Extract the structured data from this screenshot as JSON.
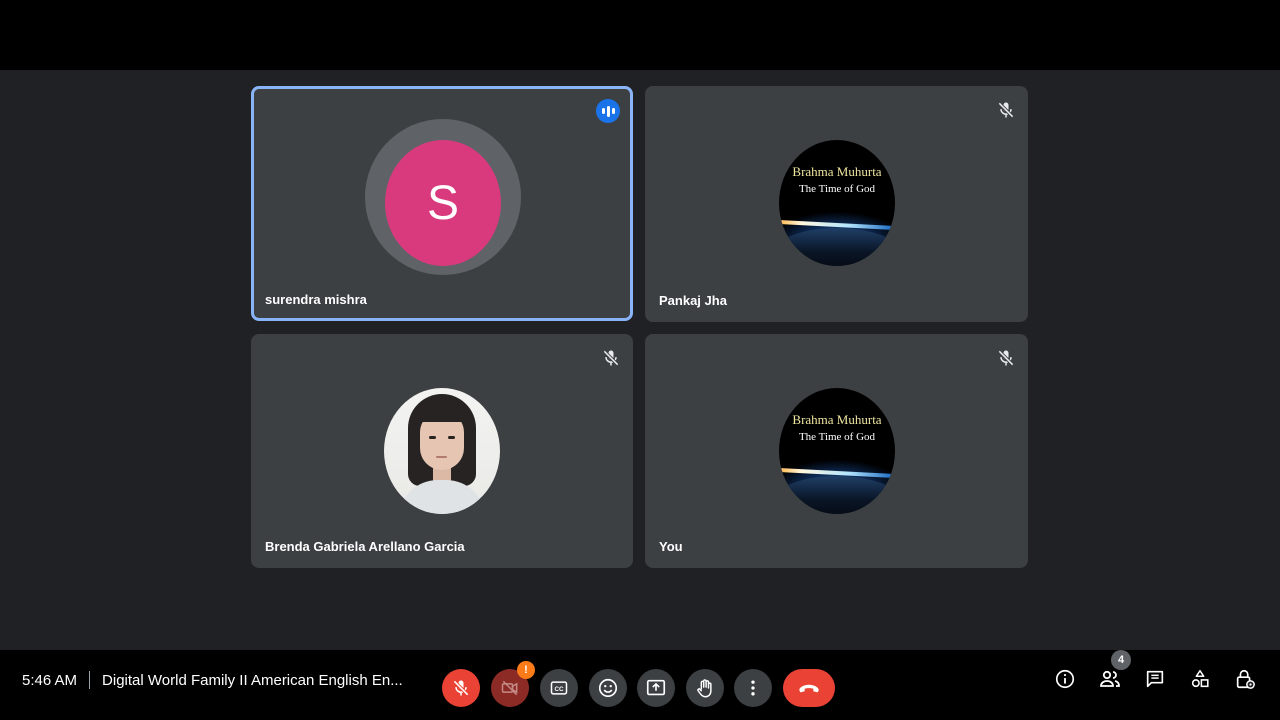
{
  "tiles": [
    {
      "name": "surendra mishra",
      "avatar_letter": "S",
      "state": "speaking"
    },
    {
      "name": "Pankaj Jha",
      "avatar_title": "Brahma Muhurta",
      "avatar_subtitle": "The Time of God",
      "state": "muted"
    },
    {
      "name": "Brenda Gabriela Arellano Garcia",
      "state": "muted"
    },
    {
      "name": "You",
      "avatar_title": "Brahma Muhurta",
      "avatar_subtitle": "The Time of God",
      "state": "muted"
    }
  ],
  "bottom_bar": {
    "time": "5:46 AM",
    "meeting_title": "Digital World Family II American English En...",
    "camera_warning": "!",
    "participants_count": "4"
  },
  "icons": {
    "mic": "mic-off-icon",
    "camera": "camera-off-icon",
    "captions": "captions-icon",
    "reactions": "emoji-icon",
    "present": "present-screen-icon",
    "hand": "raise-hand-icon",
    "more": "more-options-icon",
    "leave": "leave-call-icon",
    "info": "info-icon",
    "people": "people-icon",
    "chat": "chat-icon",
    "activities": "activities-icon",
    "host": "host-controls-icon"
  },
  "colors": {
    "background": "#202124",
    "tile": "#3c4043",
    "active_border": "#8ab4f8",
    "danger": "#ea4335",
    "avatar_s": "#d93a7d"
  }
}
